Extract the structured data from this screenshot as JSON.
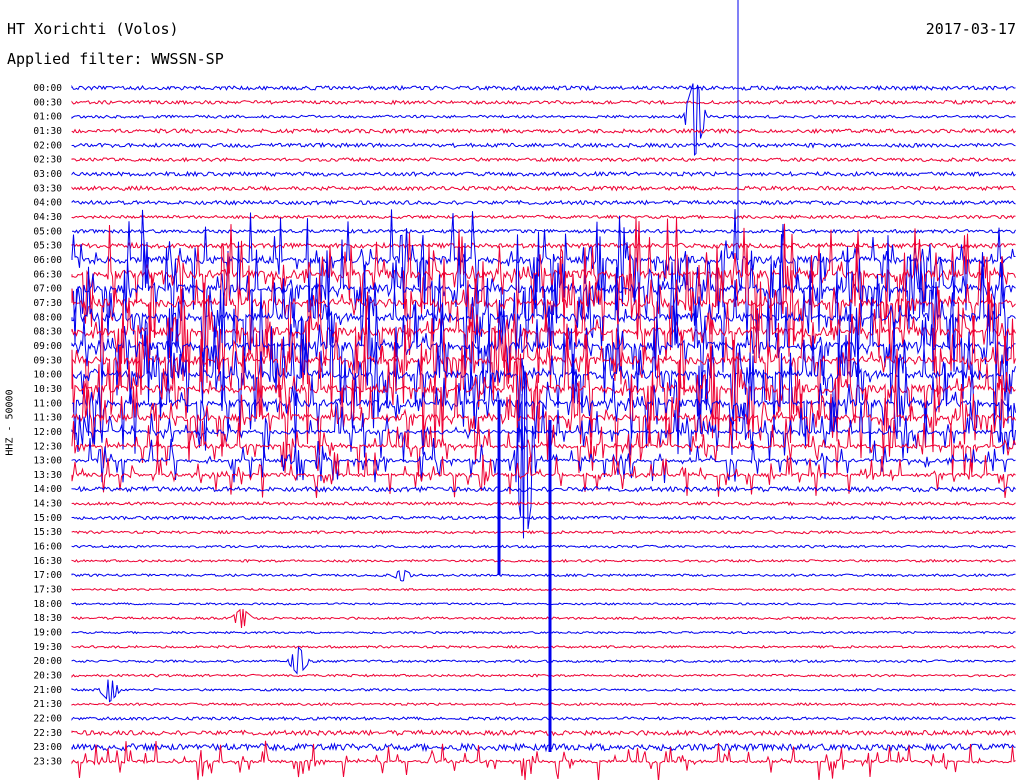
{
  "header": {
    "station": "HT Xorichti (Volos)",
    "filter": "Applied filter: WWSSN-SP",
    "date": "2017-03-17"
  },
  "channel_label": "HHZ - 50000",
  "colors": {
    "odd_trace": "#0000ee",
    "even_trace": "#ee0033",
    "text": "#000000"
  },
  "chart_data": {
    "type": "line",
    "title": "HT Xorichti (Volos)",
    "subtitle": "Applied filter: WWSSN-SP",
    "ylabel": "HHZ - 50000",
    "xlabel": "",
    "row_labels": [
      "00:00",
      "00:30",
      "01:00",
      "01:30",
      "02:00",
      "02:30",
      "03:00",
      "03:30",
      "04:00",
      "04:30",
      "05:00",
      "05:30",
      "06:00",
      "06:30",
      "07:00",
      "07:30",
      "08:00",
      "08:30",
      "09:00",
      "09:30",
      "10:00",
      "10:30",
      "11:00",
      "11:30",
      "12:00",
      "12:30",
      "13:00",
      "13:30",
      "14:00",
      "14:30",
      "15:00",
      "15:30",
      "16:00",
      "16:30",
      "17:00",
      "17:30",
      "18:00",
      "18:30",
      "19:00",
      "19:30",
      "20:00",
      "20:30",
      "21:00",
      "21:30",
      "22:00",
      "22:30",
      "23:00",
      "23:30"
    ],
    "row_activity": [
      0.15,
      0.12,
      0.08,
      0.15,
      0.15,
      0.12,
      0.15,
      0.15,
      0.15,
      0.1,
      0.12,
      0.2,
      0.9,
      1.0,
      1.0,
      1.0,
      1.0,
      1.0,
      1.0,
      1.0,
      1.0,
      1.0,
      0.9,
      0.8,
      0.5,
      0.5,
      0.4,
      0.4,
      0.2,
      0.1,
      0.1,
      0.08,
      0.06,
      0.06,
      0.06,
      0.04,
      0.04,
      0.06,
      0.04,
      0.06,
      0.06,
      0.06,
      0.05,
      0.06,
      0.1,
      0.2,
      0.3,
      0.35
    ],
    "events": [
      {
        "row": 2,
        "pos": 0.66,
        "amp": 40
      },
      {
        "row": 34,
        "pos": 0.35,
        "amp": 6
      },
      {
        "row": 37,
        "pos": 0.18,
        "amp": 10
      },
      {
        "row": 40,
        "pos": 0.24,
        "amp": 14
      },
      {
        "row": 42,
        "pos": 0.04,
        "amp": 12
      },
      {
        "row": 26,
        "pos": 0.48,
        "amp": 90
      }
    ]
  }
}
